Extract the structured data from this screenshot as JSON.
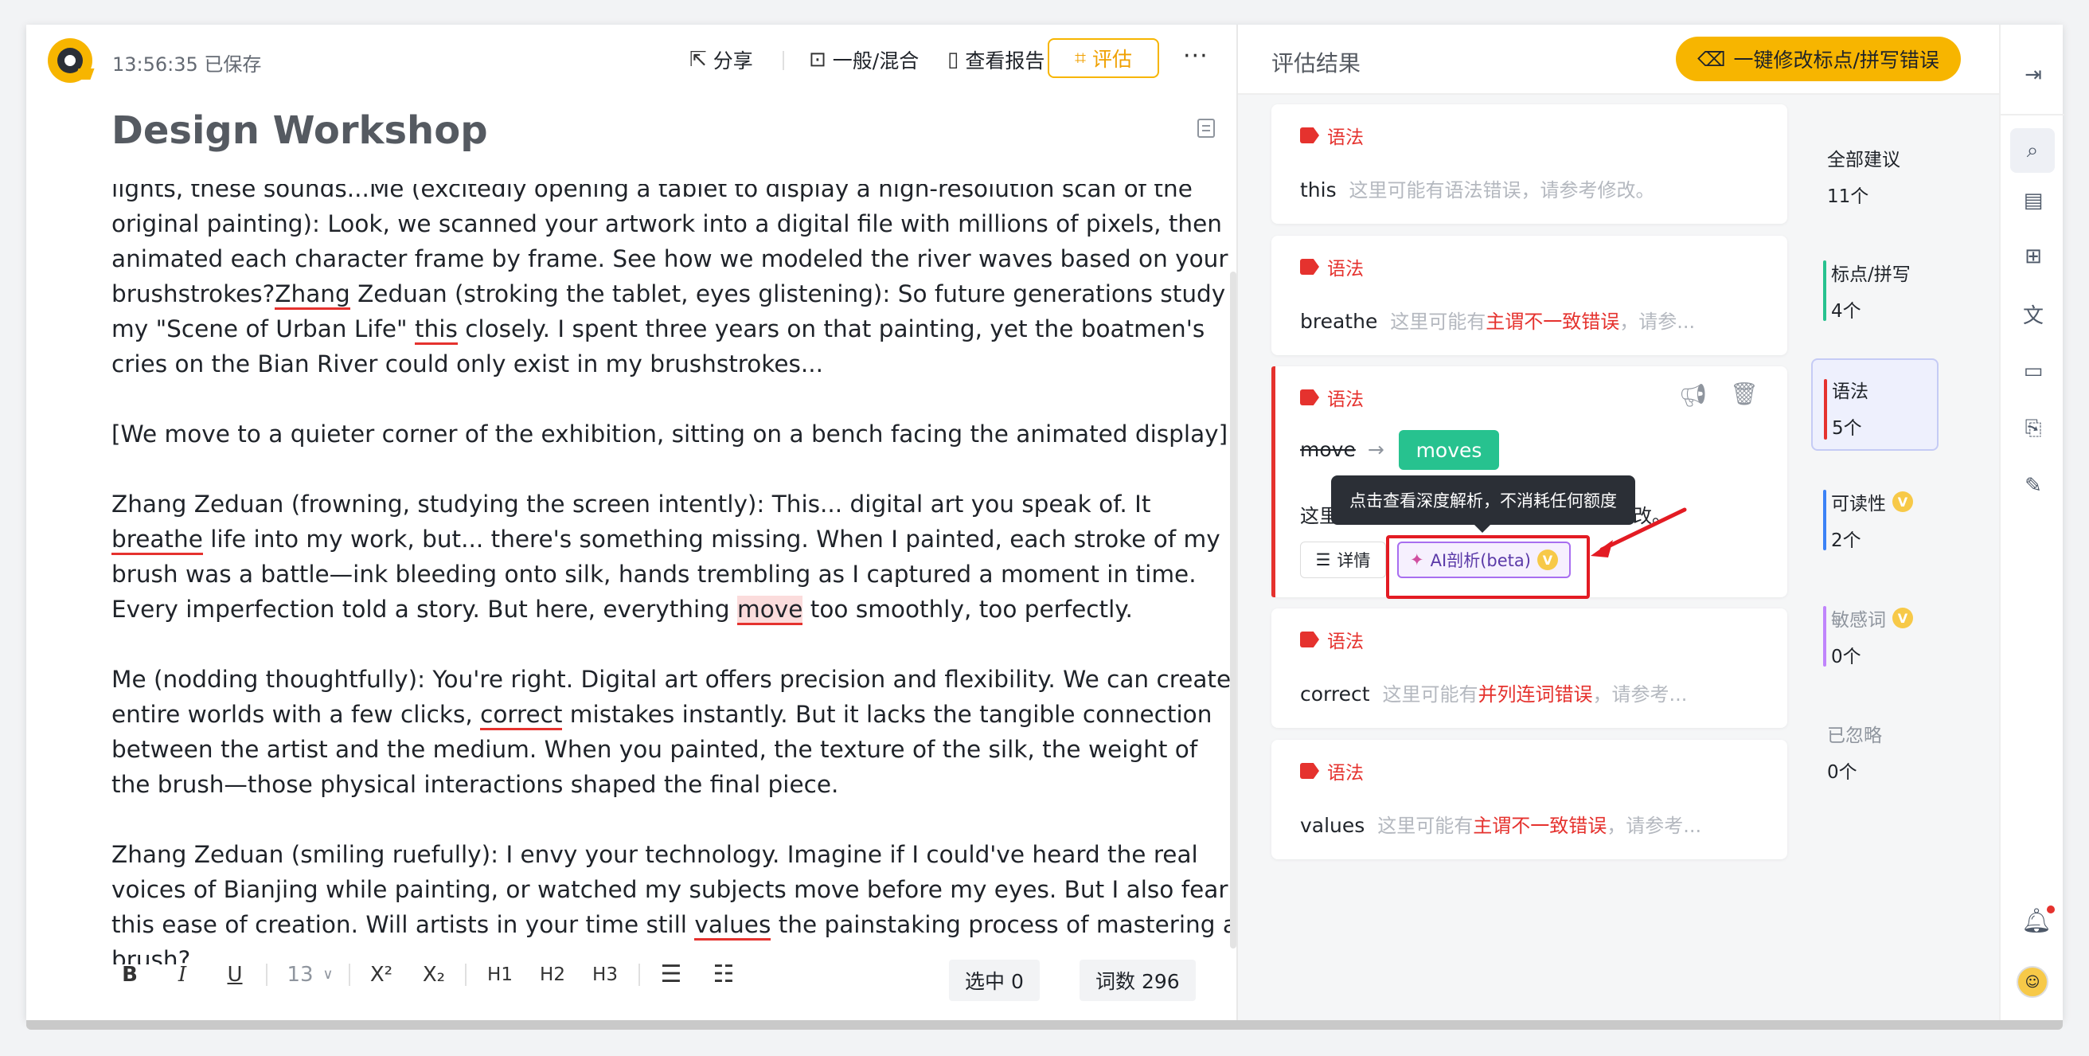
{
  "header": {
    "saved_status": "13:56:35 已保存",
    "share": "分享",
    "mode": "一般/混合",
    "report": "查看报告",
    "evaluate": "评估",
    "more": "···"
  },
  "document": {
    "title": "Design Workshop",
    "paragraphs": [
      "lights, these sounds...Me (excitedly opening a tablet to display a high-resolution scan of the original painting): Look, we scanned your artwork into a digital file with millions of pixels, then animated each character frame by frame. See how we modeled the river waves based on your brushstrokes?Zhang Zeduan (stroking the tablet, eyes glistening): So future generations study my \"Scene of Urban Life\" this closely. I spent three years on that painting, yet the boatmen's cries on the Bian River could only exist in my brushstrokes...",
      "[We move to a quieter corner of the exhibition, sitting on a bench facing the animated display]",
      "Zhang Zeduan (frowning, studying the screen intently): This... digital art you speak of. It breathe life into my work, but... there's something missing. When I painted, each stroke of my brush was a battle—ink bleeding onto silk, hands trembling as I captured a moment in time. Every imperfection told a story. But here, everything move too smoothly, too perfectly.",
      "Me (nodding thoughtfully): You're right. Digital art offers precision and flexibility. We can create entire worlds with a few clicks, correct mistakes instantly. But it lacks the tangible connection between the artist and the medium. When you painted, the texture of the silk, the weight of the brush—those physical interactions shaped the final piece.",
      "Zhang Zeduan (smiling ruefully): I envy your technology. Imagine if I could've heard the real voices of Bianjing while painting, or watched my subjects move before my eyes. But I also fear this ease of creation. Will artists in your time still values the painstaking process of mastering a brush?"
    ]
  },
  "format_bar": {
    "bold": "B",
    "italic": "I",
    "underline": "U",
    "font_size": "13",
    "superscript": "X²",
    "subscript": "X₂",
    "h1": "H1",
    "h2": "H2",
    "h3": "H3",
    "selected": "选中 0",
    "word_count": "词数 296"
  },
  "results": {
    "title": "评估结果",
    "fix_all": "一键修改标点/拼写错误",
    "cards": [
      {
        "tag": "语法",
        "word": "this",
        "hint_pre": "这里可能有语法错误，请参考修改。",
        "hint_em": "",
        "hint_post": ""
      },
      {
        "tag": "语法",
        "word": "breathe",
        "hint_pre": "这里可能有",
        "hint_em": "主谓不一致错误",
        "hint_post": "，请参..."
      },
      {
        "tag": "语法",
        "word": "move",
        "suggestion": "moves",
        "hint_pre": "这里",
        "hint_post": "改。",
        "detail": "详情",
        "ai": "AI剖析(beta)"
      },
      {
        "tag": "语法",
        "word": "correct",
        "hint_pre": "这里可能有",
        "hint_em": "并列连词错误",
        "hint_post": "，请参考..."
      },
      {
        "tag": "语法",
        "word": "values",
        "hint_pre": "这里可能有",
        "hint_em": "主谓不一致错误",
        "hint_post": "，请参考..."
      }
    ],
    "tooltip": "点击查看深度解析，不消耗任何额度"
  },
  "categories": [
    {
      "name": "全部建议",
      "count": "11个",
      "color": ""
    },
    {
      "name": "标点/拼写",
      "count": "4个",
      "color": "#27c28f"
    },
    {
      "name": "语法",
      "count": "5个",
      "color": "#e5322e"
    },
    {
      "name": "可读性",
      "count": "2个",
      "color": "#3b82f6"
    },
    {
      "name": "敏感词",
      "count": "0个",
      "color": "#c084fc"
    },
    {
      "name": "已忽略",
      "count": "0个",
      "color": ""
    }
  ],
  "colors": {
    "accent": "#f7b500",
    "error": "#e5322e",
    "success": "#27c28f"
  }
}
